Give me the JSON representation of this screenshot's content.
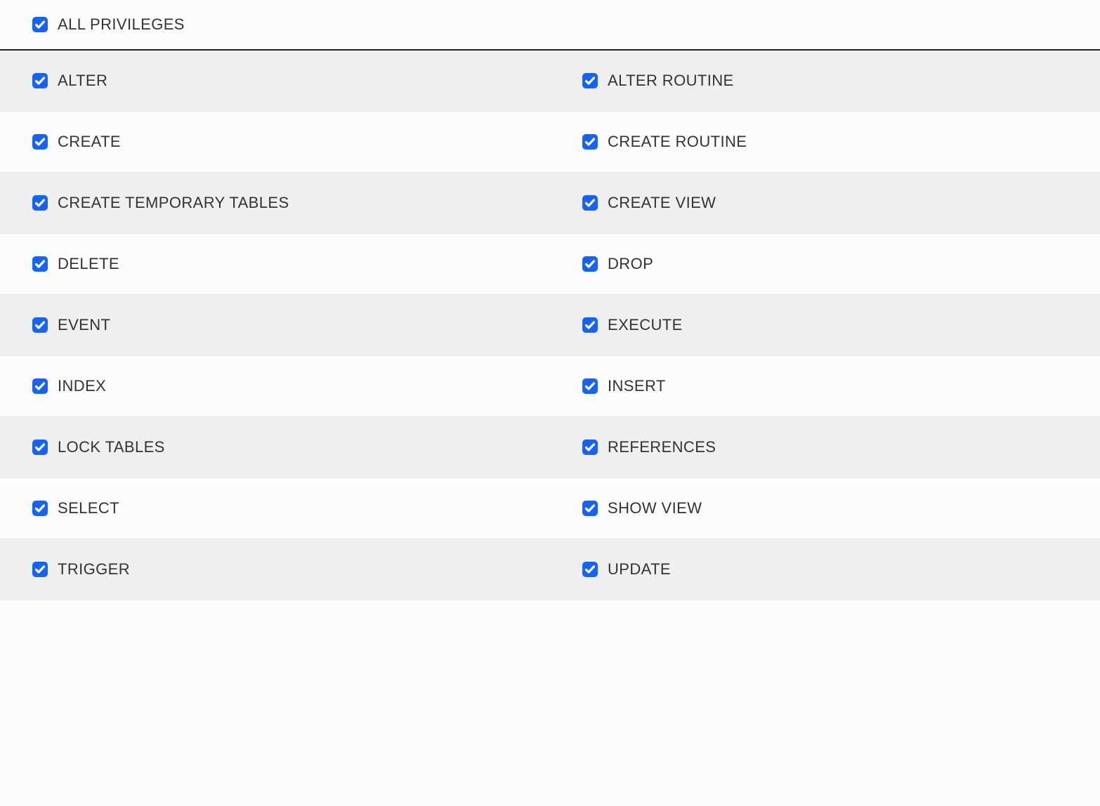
{
  "all_privileges": {
    "label": "ALL PRIVILEGES",
    "checked": true
  },
  "rows": [
    {
      "alt": true,
      "left": {
        "label": "ALTER",
        "checked": true
      },
      "right": {
        "label": "ALTER ROUTINE",
        "checked": true
      }
    },
    {
      "alt": false,
      "left": {
        "label": "CREATE",
        "checked": true
      },
      "right": {
        "label": "CREATE ROUTINE",
        "checked": true
      }
    },
    {
      "alt": true,
      "left": {
        "label": "CREATE TEMPORARY TABLES",
        "checked": true
      },
      "right": {
        "label": "CREATE VIEW",
        "checked": true
      }
    },
    {
      "alt": false,
      "left": {
        "label": "DELETE",
        "checked": true
      },
      "right": {
        "label": "DROP",
        "checked": true
      }
    },
    {
      "alt": true,
      "left": {
        "label": "EVENT",
        "checked": true
      },
      "right": {
        "label": "EXECUTE",
        "checked": true
      }
    },
    {
      "alt": false,
      "left": {
        "label": "INDEX",
        "checked": true
      },
      "right": {
        "label": "INSERT",
        "checked": true
      }
    },
    {
      "alt": true,
      "left": {
        "label": "LOCK TABLES",
        "checked": true
      },
      "right": {
        "label": "REFERENCES",
        "checked": true
      }
    },
    {
      "alt": false,
      "left": {
        "label": "SELECT",
        "checked": true
      },
      "right": {
        "label": "SHOW VIEW",
        "checked": true
      }
    },
    {
      "alt": true,
      "left": {
        "label": "TRIGGER",
        "checked": true
      },
      "right": {
        "label": "UPDATE",
        "checked": true
      }
    }
  ]
}
